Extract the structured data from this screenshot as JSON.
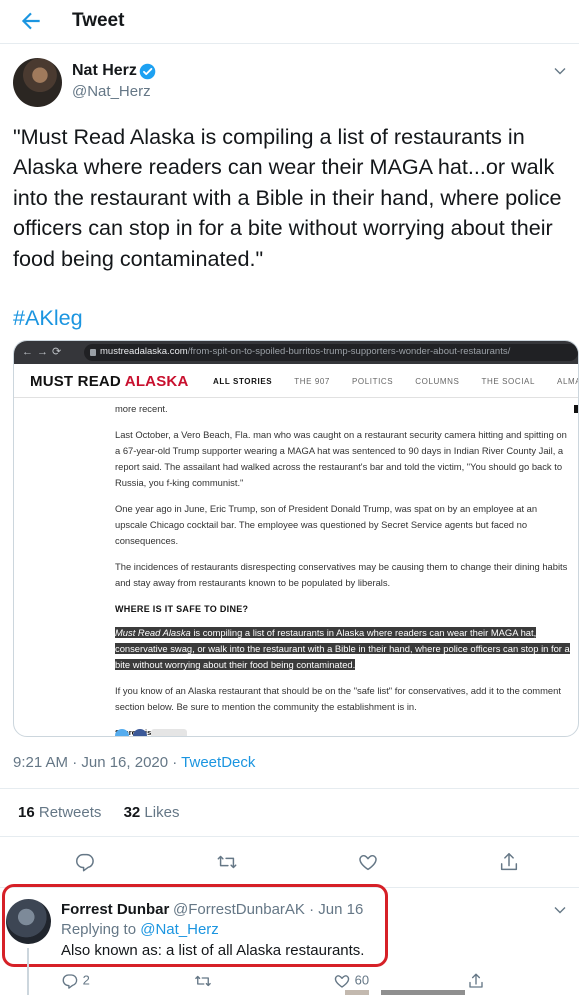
{
  "header": {
    "title": "Tweet"
  },
  "tweet": {
    "author_name": "Nat Herz",
    "author_handle": "@Nat_Herz",
    "text": "\"Must Read Alaska is compiling a list of restaurants in Alaska where readers can wear their MAGA hat...or walk into the restaurant with a Bible in their hand, where police officers can stop in for a bite without worrying about their food being contaminated.\"",
    "hashtag": "#AKleg",
    "timestamp": "9:21 AM · Jun 16, 2020 · ",
    "source": "TweetDeck",
    "retweets_count": "16",
    "retweets_label": "Retweets",
    "likes_count": "32",
    "likes_label": "Likes"
  },
  "screenshot": {
    "url_domain": "mustreadalaska.com",
    "url_path": "/from-spit-on-to-spoiled-burritos-trump-supporters-wonder-about-restaurants/",
    "logo_part1": "MUST READ ",
    "logo_part2": "ALASKA",
    "menu": [
      "ALL STORIES",
      "THE 907",
      "POLITICS",
      "COLUMNS",
      "THE SOCIAL",
      "ALMANAC"
    ],
    "p0": "more recent.",
    "p1": "Last October, a Vero Beach, Fla. man who was caught on a restaurant security camera hitting and spitting on a 67-year-old Trump supporter wearing a MAGA hat was sentenced to 90 days in Indian River County Jail, a report said. The assailant had walked across the restaurant's bar and told the victim, \"You should go back to Russia, you f-king communist.\"",
    "p2": "One year ago in June, Eric Trump, son of President Donald Trump, was spat on by an employee at an upscale Chicago cocktail bar. The employee was questioned by Secret Service agents but faced no consequences.",
    "p3": "The incidences of restaurants disrespecting conservatives may be causing them to change their dining habits and stay away from restaurants known to be populated by liberals.",
    "heading": "WHERE IS IT SAFE TO DINE?",
    "highlight_italic": "Must Read Alaska",
    "highlight_rest": " is compiling a list of restaurants in Alaska where readers can wear their MAGA hat, conservative swag, or walk into the restaurant with a Bible in their hand, where police officers can stop in for a bite without worrying about their food being contaminated.",
    "p5": "If you know of an Alaska restaurant that should be on the \"safe list\" for conservatives, add it to the comment section below. Be sure to mention the community the establishment is in.",
    "share_label": "Share this:"
  },
  "reply": {
    "author_name": "Forrest Dunbar",
    "meta": "@ForrestDunbarAK · Jun 16",
    "replying_prefix": "Replying to ",
    "replying_to": "@Nat_Herz",
    "text": "Also known as: a list of all Alaska restaurants.",
    "reply_count": "2",
    "like_count": "60"
  },
  "colors": {
    "accent": "#1b95e0",
    "muted": "#657786",
    "highlight_box": "#d62027"
  },
  "icons": [
    "back-arrow-icon",
    "verified-badge-icon",
    "chevron-down-icon",
    "reply-icon",
    "retweet-icon",
    "like-icon",
    "share-icon"
  ]
}
